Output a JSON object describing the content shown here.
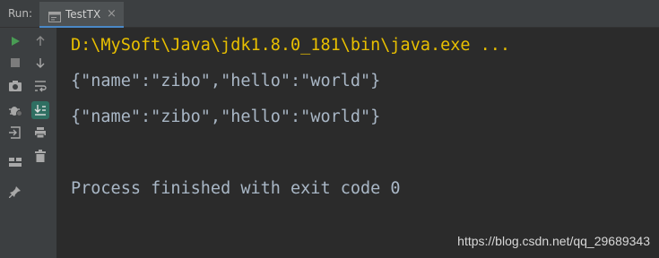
{
  "header": {
    "run_label": "Run:",
    "tab": {
      "label": "TestTX",
      "close": "×",
      "underline_color": "#4a88c7"
    }
  },
  "toolbar": {
    "buttons": [
      {
        "name": "rerun-icon",
        "glyph": "▶",
        "color": "#499c54"
      },
      {
        "name": "stop-icon",
        "glyph": "■",
        "color": "#7c7c7c"
      },
      {
        "name": "camera-icon",
        "glyph": "📷",
        "color": "#b0b0b0"
      },
      {
        "name": "debug-settings-icon",
        "glyph": "⚙",
        "color": "#b0b0b0"
      },
      {
        "name": "login-icon",
        "glyph": "⇥",
        "color": "#b0b0b0"
      },
      {
        "name": "layout-icon",
        "glyph": "▀",
        "color": "#b0b0b0"
      },
      {
        "name": "pin-icon",
        "glyph": "📌",
        "color": "#b0b0b0"
      },
      {
        "name": "up-arrow-icon",
        "glyph": "↑",
        "color": "#9a9a9a"
      },
      {
        "name": "down-arrow-icon",
        "glyph": "↓",
        "color": "#b0b0b0"
      },
      {
        "name": "soft-wrap-icon",
        "glyph": "⤶",
        "color": "#b0b0b0"
      },
      {
        "name": "scroll-to-end-icon",
        "glyph": "⇊",
        "color": "#d0d0d0"
      },
      {
        "name": "print-icon",
        "glyph": "🖶",
        "color": "#b0b0b0"
      },
      {
        "name": "trash-icon",
        "glyph": "🗑",
        "color": "#b0b0b0"
      }
    ]
  },
  "console": {
    "lines": [
      "D:\\MySoft\\Java\\jdk1.8.0_181\\bin\\java.exe ...",
      "{\"name\":\"zibo\",\"hello\":\"world\"}",
      "{\"name\":\"zibo\",\"hello\":\"world\"}",
      "",
      "Process finished with exit code 0"
    ],
    "command_color": "#e8bf00",
    "output_color": "#a9b7c6"
  },
  "watermark": "https://blog.csdn.net/qq_29689343"
}
